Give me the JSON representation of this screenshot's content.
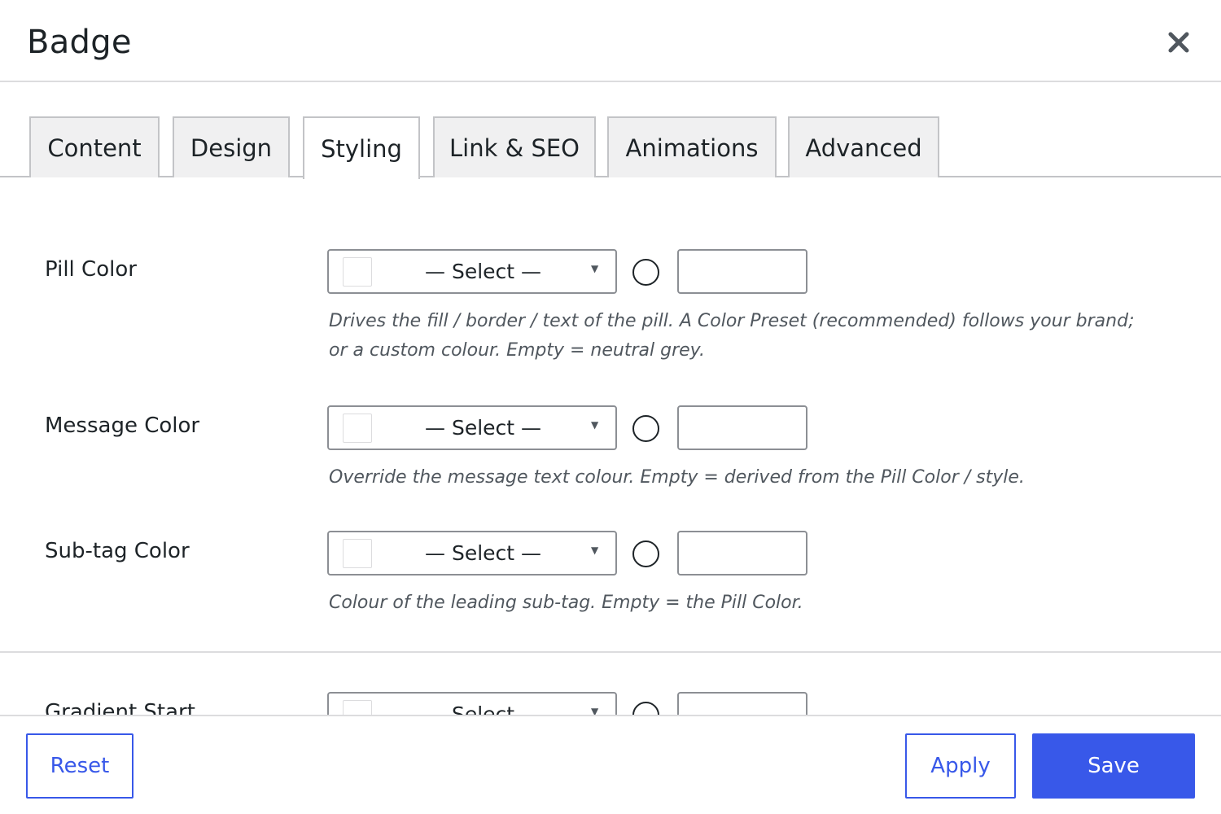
{
  "dialog": {
    "title": "Badge",
    "close_icon": "close-icon"
  },
  "tabs": [
    {
      "label": "Content",
      "active": false
    },
    {
      "label": "Design",
      "active": false
    },
    {
      "label": "Styling",
      "active": true
    },
    {
      "label": "Link & SEO",
      "active": false
    },
    {
      "label": "Animations",
      "active": false
    },
    {
      "label": "Advanced",
      "active": false
    }
  ],
  "fields": [
    {
      "label": "Pill Color",
      "select_value": "— Select —",
      "hex_value": "",
      "description": "Drives the fill / border / text of the pill. A Color Preset (recommended) follows your brand; or a custom colour. Empty = neutral grey."
    },
    {
      "label": "Message Color",
      "select_value": "— Select —",
      "hex_value": "",
      "description": "Override the message text colour. Empty = derived from the Pill Color / style."
    },
    {
      "label": "Sub-tag Color",
      "select_value": "— Select —",
      "hex_value": "",
      "description": "Colour of the leading sub-tag. Empty = the Pill Color."
    },
    {
      "label": "Gradient Start",
      "select_value": "— Select —",
      "hex_value": "",
      "description": ""
    }
  ],
  "footer": {
    "reset_label": "Reset",
    "apply_label": "Apply",
    "save_label": "Save"
  },
  "colors": {
    "accent": "#3858e9",
    "border": "#8c8f94",
    "tab_bg": "#f0f0f1",
    "muted_text": "#50575e"
  }
}
